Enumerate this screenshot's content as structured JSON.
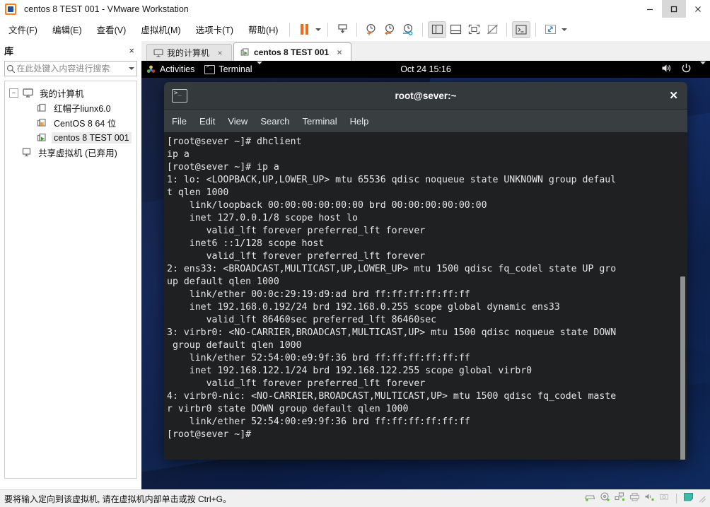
{
  "window": {
    "title": "centos 8 TEST 001 - VMware Workstation",
    "logo_icon": "vmware-logo-icon",
    "controls": [
      {
        "name": "minimize",
        "glyph": "minimize-icon"
      },
      {
        "name": "maximize",
        "glyph": "maximize-icon"
      },
      {
        "name": "close",
        "glyph": "close-icon"
      }
    ]
  },
  "menubar": {
    "items": [
      {
        "label": "文件(F)",
        "accel": "F"
      },
      {
        "label": "编辑(E)",
        "accel": "E"
      },
      {
        "label": "查看(V)",
        "accel": "V"
      },
      {
        "label": "虚拟机(M)",
        "accel": "M"
      },
      {
        "label": "选项卡(T)",
        "accel": "T"
      },
      {
        "label": "帮助(H)",
        "accel": "H"
      }
    ]
  },
  "toolbar": {
    "buttons": [
      {
        "name": "suspend-button",
        "icon": "pause-icon"
      },
      {
        "name": "power-dropdown",
        "icon": "chevron-down-icon"
      },
      {
        "name": "snapshot-manager-button",
        "icon": "snapshot-icon"
      },
      {
        "name": "take-snapshot-button",
        "icon": "clock-plus-icon"
      },
      {
        "name": "revert-snapshot-button",
        "icon": "clock-back-icon"
      },
      {
        "name": "manage-snapshots-button",
        "icon": "clock-wrench-icon"
      },
      {
        "name": "show-library-button",
        "icon": "sidebar-left-icon"
      },
      {
        "name": "show-thumbnail-bar-button",
        "icon": "panel-bottom-icon"
      },
      {
        "name": "fullscreen-button",
        "icon": "fullscreen-icon"
      },
      {
        "name": "unity-mode-button",
        "icon": "unity-off-icon"
      },
      {
        "name": "console-button",
        "icon": "terminal-icon"
      },
      {
        "name": "stretch-button",
        "icon": "expand-arrows-icon"
      },
      {
        "name": "stretch-dropdown",
        "icon": "chevron-down-icon"
      }
    ]
  },
  "library": {
    "title": "库",
    "close_glyph": "×",
    "search": {
      "placeholder": "在此处键入内容进行搜索",
      "value": "",
      "icon": "search-icon",
      "dropdown_icon": "chevron-down-icon"
    },
    "tree": [
      {
        "label": "我的计算机",
        "level": 0,
        "icon": "computer-icon",
        "expander": "−",
        "selected": false
      },
      {
        "label": "红帽子liunx6.0",
        "level": 1,
        "icon": "vm-stopped-icon",
        "selected": false
      },
      {
        "label": "CentOS 8 64 位",
        "level": 1,
        "icon": "vm-suspended-icon",
        "selected": false
      },
      {
        "label": "centos 8 TEST 001",
        "level": 1,
        "icon": "vm-running-icon",
        "selected": true
      },
      {
        "label": "共享虚拟机 (已弃用)",
        "level": 0,
        "icon": "shared-vm-icon",
        "selected": false
      }
    ]
  },
  "tabs": [
    {
      "label": "我的计算机",
      "icon": "computer-icon",
      "active": false,
      "close_glyph": "×"
    },
    {
      "label": "centos 8 TEST 001",
      "icon": "vm-running-icon",
      "active": true,
      "close_glyph": "×"
    }
  ],
  "guest": {
    "topbar": {
      "activities": "Activities",
      "activities_icon": "gnome-activities-icon",
      "app_name": "Terminal",
      "app_icon": "terminal-icon",
      "app_dropdown_icon": "chevron-down-icon",
      "clock": "Oct 24 15:16",
      "volume_icon": "speaker-icon",
      "power_icon": "power-icon",
      "menu_icon": "chevron-down-icon"
    },
    "terminal": {
      "title": "root@sever:~",
      "titlebar_icon": "terminal-icon",
      "close_glyph": "✕",
      "menu": [
        "File",
        "Edit",
        "View",
        "Search",
        "Terminal",
        "Help"
      ],
      "content": "[root@sever ~]# dhclient\nip a\n[root@sever ~]# ip a\n1: lo: <LOOPBACK,UP,LOWER_UP> mtu 65536 qdisc noqueue state UNKNOWN group defaul\nt qlen 1000\n    link/loopback 00:00:00:00:00:00 brd 00:00:00:00:00:00\n    inet 127.0.0.1/8 scope host lo\n       valid_lft forever preferred_lft forever\n    inet6 ::1/128 scope host\n       valid_lft forever preferred_lft forever\n2: ens33: <BROADCAST,MULTICAST,UP,LOWER_UP> mtu 1500 qdisc fq_codel state UP gro\nup default qlen 1000\n    link/ether 00:0c:29:19:d9:ad brd ff:ff:ff:ff:ff:ff\n    inet 192.168.0.192/24 brd 192.168.0.255 scope global dynamic ens33\n       valid_lft 86460sec preferred_lft 86460sec\n3: virbr0: <NO-CARRIER,BROADCAST,MULTICAST,UP> mtu 1500 qdisc noqueue state DOWN\n group default qlen 1000\n    link/ether 52:54:00:e9:9f:36 brd ff:ff:ff:ff:ff:ff\n    inet 192.168.122.1/24 brd 192.168.122.255 scope global virbr0\n       valid_lft forever preferred_lft forever\n4: virbr0-nic: <NO-CARRIER,BROADCAST,MULTICAST,UP> mtu 1500 qdisc fq_codel maste\nr virbr0 state DOWN group default qlen 1000\n    link/ether 52:54:00:e9:9f:36 brd ff:ff:ff:ff:ff:ff\n[root@sever ~]# "
    }
  },
  "statusbar": {
    "message": "要将输入定向到该虚拟机, 请在虚拟机内部单击或按 Ctrl+G。",
    "devices": [
      {
        "name": "hard-disk-icon"
      },
      {
        "name": "cd-dvd-icon"
      },
      {
        "name": "network-adapter-icon"
      },
      {
        "name": "printer-icon"
      },
      {
        "name": "sound-card-icon"
      },
      {
        "name": "camera-icon"
      }
    ],
    "indicator_icon": "display-indicator-icon",
    "grip_icon": "resize-grip-icon"
  },
  "colors": {
    "accent_orange": "#ef6a1b",
    "vm_running_green": "#3f9b2f",
    "vm_suspended_orange": "#ef8a1b",
    "terminal_bg": "#1e2021",
    "terminal_fg": "#e6e6e6",
    "desktop_blue": "#0d1c45",
    "status_indicator": "#3fb8a8"
  }
}
